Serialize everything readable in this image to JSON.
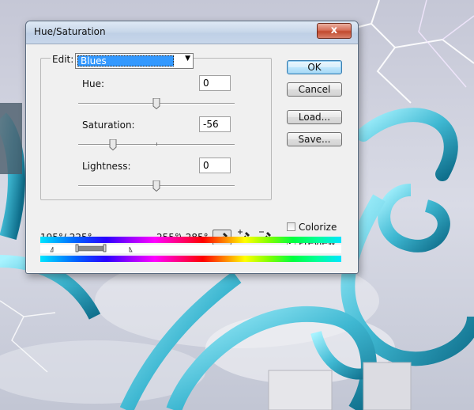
{
  "window": {
    "title": "Hue/Saturation",
    "close_glyph": "x"
  },
  "edit": {
    "label": "Edit:",
    "selected": "Blues"
  },
  "sliders": {
    "hue": {
      "label": "Hue:",
      "value": "0",
      "level": 0.5
    },
    "saturation": {
      "label": "Saturation:",
      "value": "-56",
      "level": 0.22
    },
    "lightness": {
      "label": "Lightness:",
      "value": "0",
      "level": 0.5
    }
  },
  "buttons": {
    "ok": "OK",
    "cancel": "Cancel",
    "load": "Load...",
    "save": "Save..."
  },
  "options": {
    "colorize": {
      "label": "Colorize",
      "checked": false
    },
    "preview": {
      "label": "Preview",
      "checked": true
    }
  },
  "range": {
    "left": "195°/ 225°",
    "right": "255°\\ 285°"
  },
  "icons": {
    "eyedropper": "eyedropper-icon",
    "eyedropper_add": "eyedropper-plus-icon",
    "eyedropper_subtract": "eyedropper-minus-icon"
  },
  "colors": {
    "selection_highlight": "#3399ff",
    "close_button": "#c9543a",
    "default_button_border": "#3c7fb1"
  }
}
